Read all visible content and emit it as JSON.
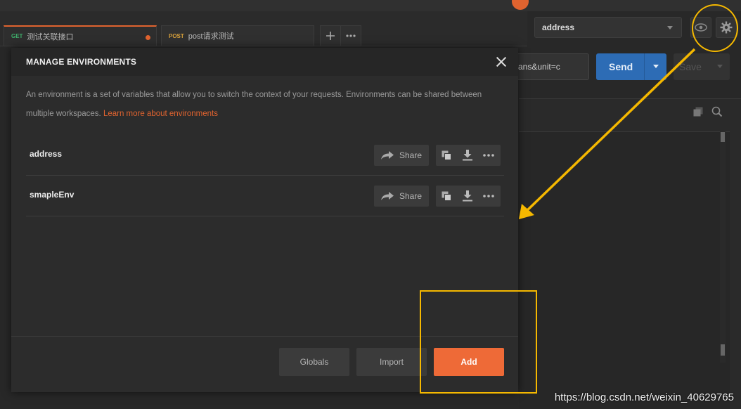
{
  "tabs": [
    {
      "method": "GET",
      "name": "测试关联接口",
      "unsaved": true
    },
    {
      "method": "POST",
      "name": "post请求测试",
      "unsaved": false
    }
  ],
  "environment_selector": {
    "selected": "address"
  },
  "request": {
    "url_fragment": "ans&unit=c",
    "send_label": "Send",
    "save_label": "Save"
  },
  "modal": {
    "title": "MANAGE ENVIRONMENTS",
    "description": "An environment is a set of variables that allow you to switch the context of your requests. Environments can be shared between multiple workspaces.",
    "learn_more": "Learn more about environments",
    "environments": [
      {
        "name": "address",
        "share_label": "Share"
      },
      {
        "name": "smapleEnv",
        "share_label": "Share"
      }
    ],
    "buttons": {
      "globals": "Globals",
      "import": "Import",
      "add": "Add"
    }
  },
  "watermark": "https://blog.csdn.net/weixin_40629765",
  "colors": {
    "accent": "#ee6a37",
    "send": "#2d6cb5",
    "highlight": "#f5b800",
    "background": "#282828"
  },
  "icons": [
    "share-arrow-icon",
    "duplicate-icon",
    "download-icon",
    "more-icon",
    "eye-icon",
    "gear-icon",
    "close-icon",
    "plus-icon",
    "search-icon",
    "copy-icon"
  ]
}
